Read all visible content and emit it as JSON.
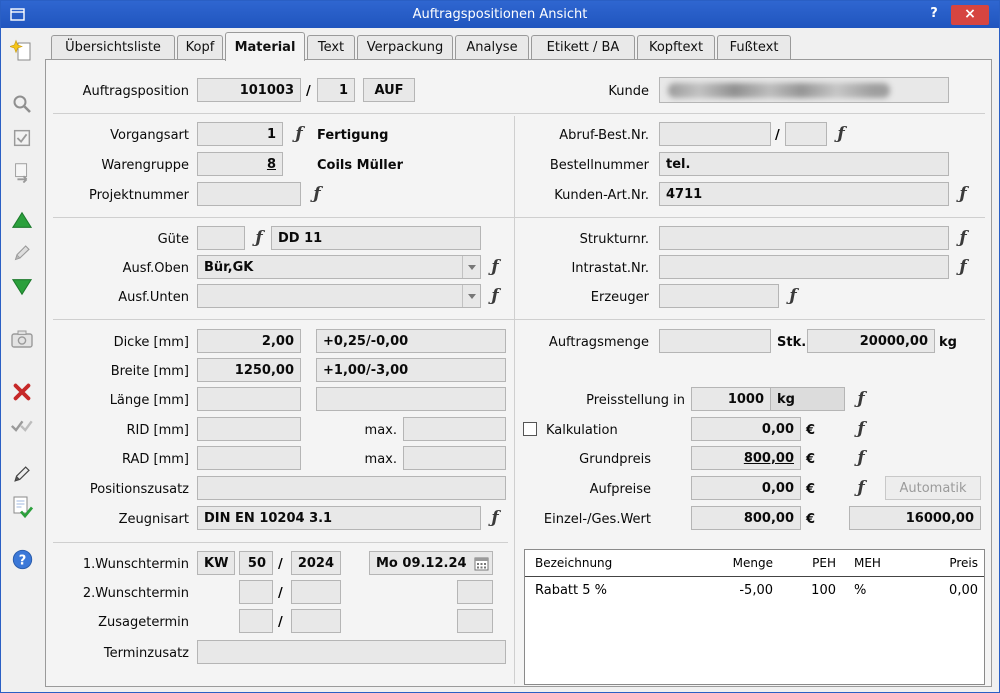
{
  "window": {
    "title": "Auftragspositionen Ansicht",
    "help_label": "?",
    "close_label": "×"
  },
  "colors": {
    "titlebar_blue": "#2a5fc4",
    "close_red": "#d64541",
    "arrow_green": "#2ba03c",
    "delete_red": "#c62828",
    "help_blue": "#3b78d8",
    "field_gray": "#e8e8e8"
  },
  "icons": {
    "function_glyph": "ƒ",
    "help_glyph": "?"
  },
  "tabs": {
    "items": [
      {
        "label": "Übersichtsliste"
      },
      {
        "label": "Kopf"
      },
      {
        "label": "Material"
      },
      {
        "label": "Text"
      },
      {
        "label": "Verpackung"
      },
      {
        "label": "Analyse"
      },
      {
        "label": "Etikett / BA"
      },
      {
        "label": "Kopftext"
      },
      {
        "label": "Fußtext"
      }
    ],
    "active": "Material"
  },
  "header": {
    "auftragsposition_label": "Auftragsposition",
    "auftragsposition_nr": "101003",
    "slash": "/",
    "position_nr": "1",
    "auftragsart": "AUF",
    "kunde_label": "Kunde"
  },
  "left": {
    "vorgangsart": {
      "label": "Vorgangsart",
      "value": "1",
      "text": "Fertigung"
    },
    "warengruppe": {
      "label": "Warengruppe",
      "value": "8",
      "text": "Coils Müller"
    },
    "projektnummer": {
      "label": "Projektnummer",
      "value": ""
    },
    "guete": {
      "label": "Güte",
      "code": "",
      "text": "DD 11"
    },
    "ausf_oben": {
      "label": "Ausf.Oben",
      "value": "Bür,GK"
    },
    "ausf_unten": {
      "label": "Ausf.Unten",
      "value": ""
    },
    "dicke": {
      "label": "Dicke [mm]",
      "value": "2,00",
      "toleranz": "+0,25/-0,00"
    },
    "breite": {
      "label": "Breite [mm]",
      "value": "1250,00",
      "toleranz": "+1,00/-3,00"
    },
    "laenge": {
      "label": "Länge [mm]",
      "value": "",
      "toleranz": ""
    },
    "rid": {
      "label": "RID [mm]",
      "value": "",
      "max_label": "max.",
      "max_value": ""
    },
    "rad": {
      "label": "RAD [mm]",
      "value": "",
      "max_label": "max.",
      "max_value": ""
    },
    "positionszusatz": {
      "label": "Positionszusatz",
      "value": ""
    },
    "zeugnisart": {
      "label": "Zeugnisart",
      "value": "DIN EN 10204 3.1"
    },
    "wunschtermin1": {
      "label": "1.Wunschtermin",
      "kw_label": "KW",
      "kw": "50",
      "slash": "/",
      "jahr": "2024",
      "datum": "Mo 09.12.24"
    },
    "wunschtermin2": {
      "label": "2.Wunschtermin",
      "kw": "",
      "slash": "/",
      "jahr": "",
      "datum": ""
    },
    "zusagetermin": {
      "label": "Zusagetermin",
      "kw": "",
      "slash": "/",
      "jahr": "",
      "datum": ""
    },
    "terminzusatz": {
      "label": "Terminzusatz",
      "value": ""
    }
  },
  "right": {
    "abruf_bestnr": {
      "label": "Abruf-Best.Nr.",
      "value1": "",
      "slash": "/",
      "value2": ""
    },
    "bestellnummer": {
      "label": "Bestellnummer",
      "value": "tel."
    },
    "kunden_artnr": {
      "label": "Kunden-Art.Nr.",
      "value": "4711"
    },
    "strukturnr": {
      "label": "Strukturnr.",
      "value": ""
    },
    "intrastat": {
      "label": "Intrastat.Nr.",
      "value": ""
    },
    "erzeuger": {
      "label": "Erzeuger",
      "value": ""
    },
    "auftragsmenge": {
      "label": "Auftragsmenge",
      "stk_value": "",
      "stk_label": "Stk.",
      "kg_value": "20000,00",
      "kg_label": "kg"
    },
    "preisstellung": {
      "label": "Preisstellung in",
      "value": "1000",
      "unit": "kg"
    },
    "kalkulation": {
      "label": "Kalkulation",
      "value": "0,00",
      "currency": "€"
    },
    "grundpreis": {
      "label": "Grundpreis",
      "value": "800,00",
      "currency": "€"
    },
    "aufpreise": {
      "label": "Aufpreise",
      "value": "0,00",
      "currency": "€",
      "button": "Automatik"
    },
    "einzel_ges_wert": {
      "label": "Einzel-/Ges.Wert",
      "einzel": "800,00",
      "currency": "€",
      "gesamt": "16000,00"
    }
  },
  "zuschlaege_tabelle": {
    "headers": [
      "Bezeichnung",
      "Menge",
      "PEH",
      "MEH",
      "Preis"
    ],
    "rows": [
      {
        "bezeichnung": "Rabatt 5 %",
        "menge": "-5,00",
        "peh": "100",
        "meh": "%",
        "preis": "0,00"
      }
    ]
  }
}
